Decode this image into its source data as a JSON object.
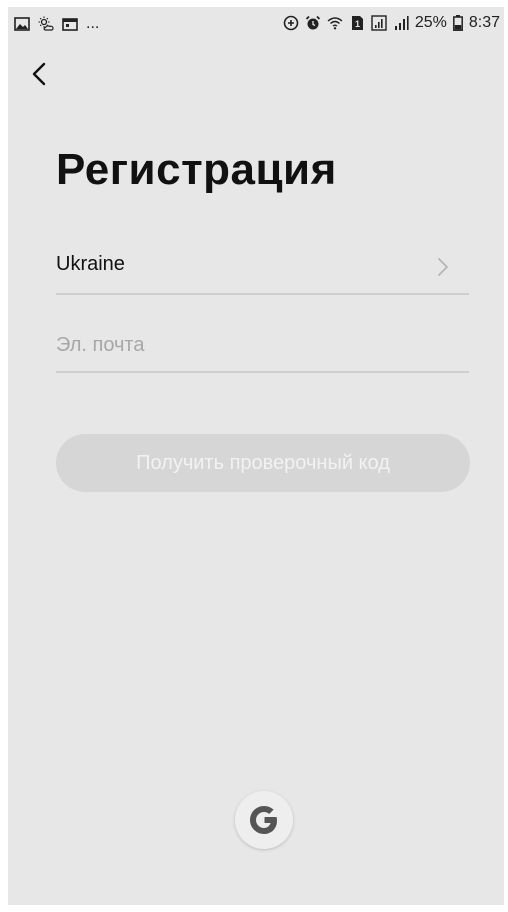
{
  "status_bar": {
    "left_icons": [
      "image-icon",
      "weather-icon",
      "calendar-icon"
    ],
    "overflow": "...",
    "right_icons": [
      "data-saver-icon",
      "alarm-icon",
      "wifi-icon",
      "sim-icon",
      "signal-icon",
      "signal-bars-icon"
    ],
    "battery_percent": "25%",
    "time": "8:37"
  },
  "header": {
    "back_icon": "chevron-left-icon"
  },
  "main": {
    "title": "Регистрация",
    "country": {
      "value": "Ukraine",
      "icon": "chevron-right-icon"
    },
    "email": {
      "placeholder": "Эл. почта",
      "value": ""
    },
    "get_code_button": {
      "label": "Получить проверочный код",
      "enabled": false
    },
    "social_login": {
      "icon": "google-icon"
    }
  },
  "colors": {
    "background": "#e7e7e7",
    "button_disabled": "#d6d6d6",
    "divider": "#cfcfcf",
    "title": "#111111"
  }
}
